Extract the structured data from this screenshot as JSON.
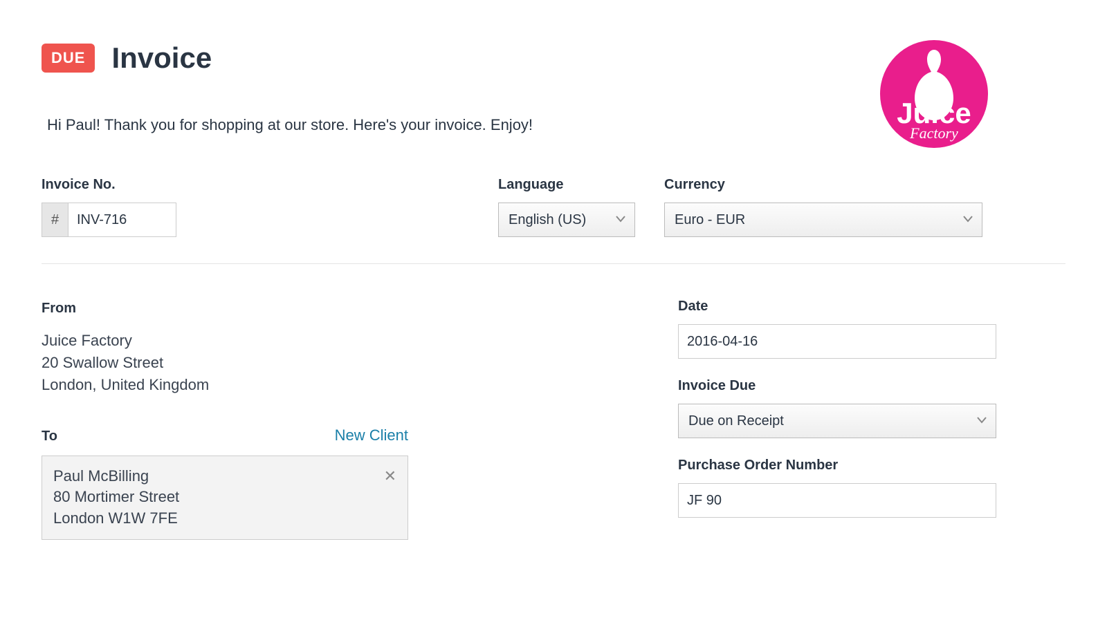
{
  "header": {
    "status_badge": "DUE",
    "title": "Invoice",
    "greeting": "Hi Paul! Thank you for shopping at our store. Here's your invoice. Enjoy!"
  },
  "logo": {
    "brand_top": "Juice",
    "brand_bottom": "Factory",
    "bg_color": "#e91e8c",
    "fg_color": "#ffffff"
  },
  "fields": {
    "invoice_no": {
      "label": "Invoice No.",
      "prefix": "#",
      "value": "INV-716"
    },
    "language": {
      "label": "Language",
      "value": "English (US)"
    },
    "currency": {
      "label": "Currency",
      "value": "Euro - EUR"
    }
  },
  "from": {
    "heading": "From",
    "name": "Juice Factory",
    "line1": "20 Swallow Street",
    "line2": "London, United Kingdom"
  },
  "to": {
    "heading": "To",
    "new_client_label": "New Client",
    "name": "Paul McBilling",
    "line1": "80 Mortimer Street",
    "line2": "London W1W 7FE"
  },
  "right": {
    "date": {
      "label": "Date",
      "value": "2016-04-16"
    },
    "invoice_due": {
      "label": "Invoice Due",
      "value": "Due on Receipt"
    },
    "po": {
      "label": "Purchase Order Number",
      "value": "JF 90"
    }
  }
}
